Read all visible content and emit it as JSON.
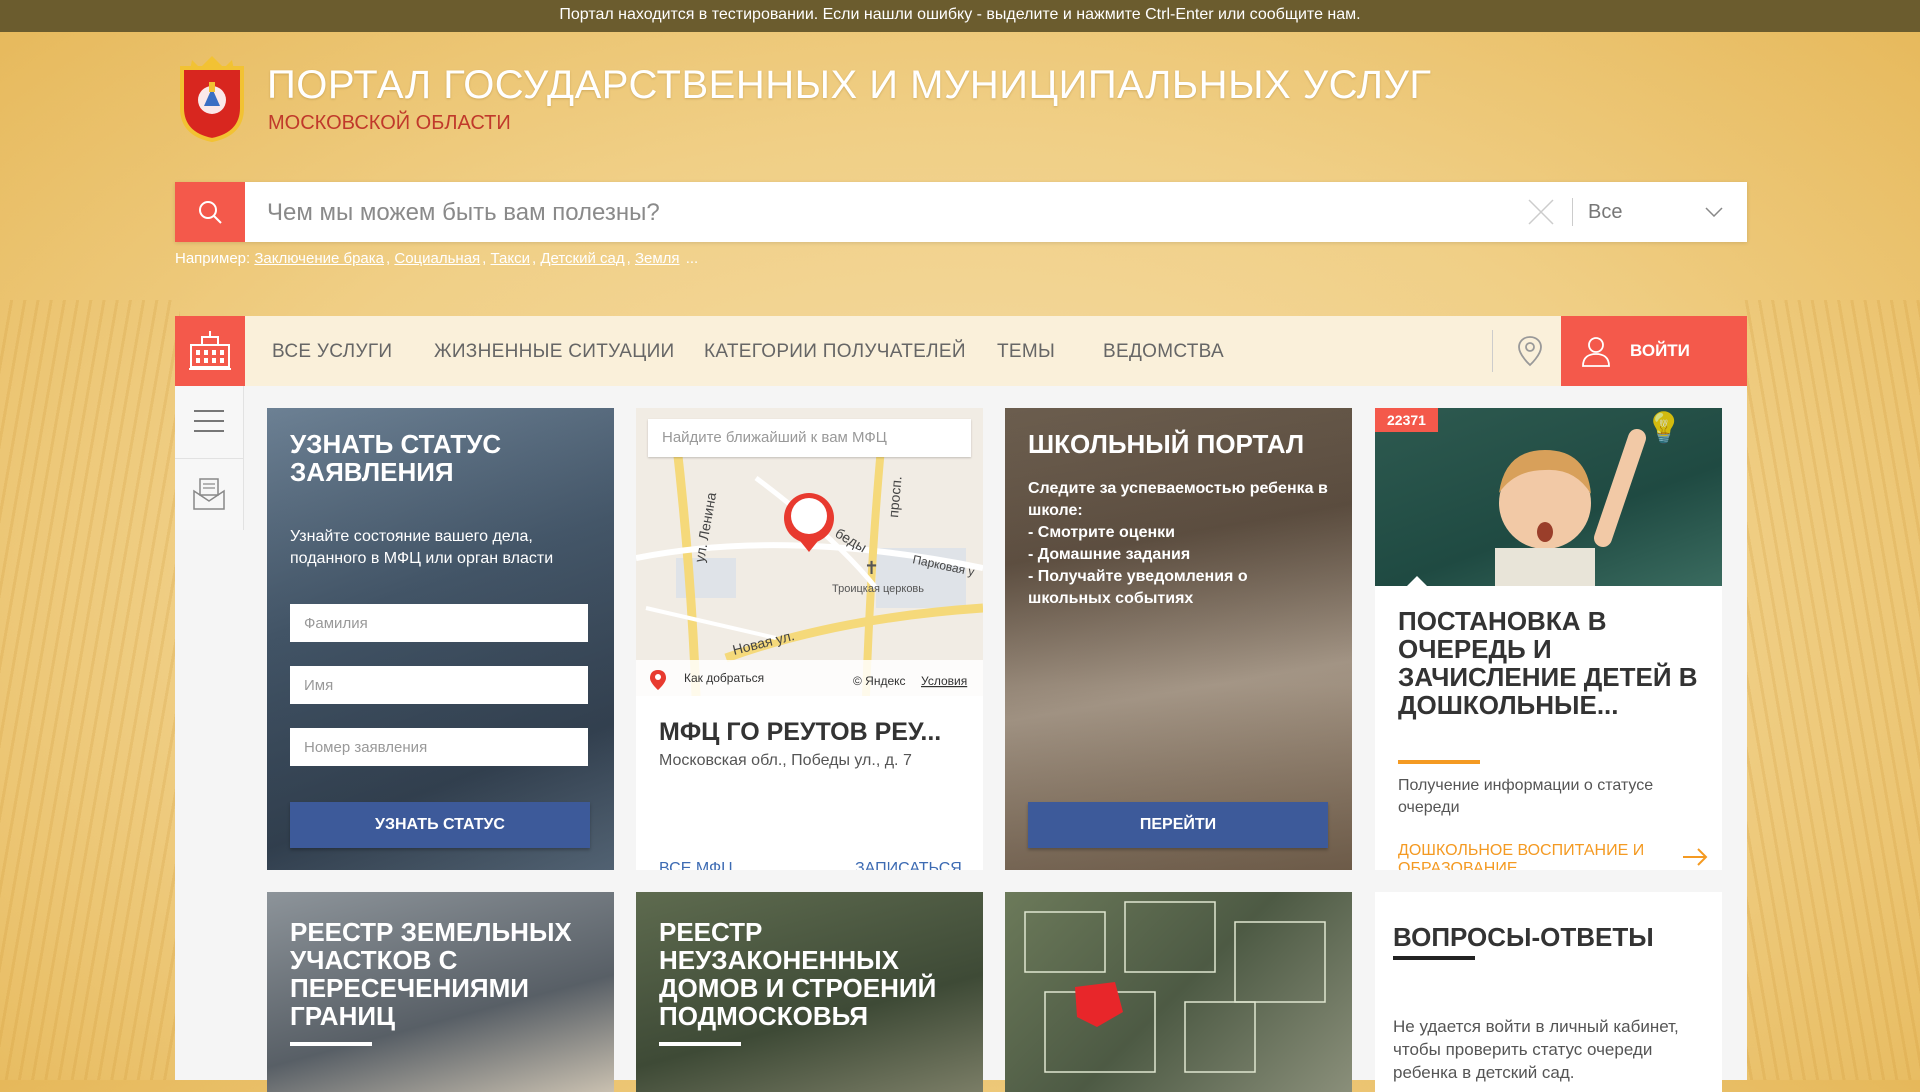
{
  "topbar": {
    "text": "Портал находится в тестировании. Если нашли ошибку - выделите и нажмите Ctrl-Enter или сообщите нам."
  },
  "header": {
    "title": "ПОРТАЛ ГОСУДАРСТВЕННЫХ И МУНИЦИПАЛЬНЫХ УСЛУГ",
    "subtitle": "МОСКОВСКОЙ ОБЛАСТИ"
  },
  "search": {
    "placeholder": "Чем мы можем быть вам полезны?",
    "scope": "Все"
  },
  "examples": {
    "label": "Например:",
    "items": [
      "Заключение брака",
      "Социальная",
      "Такси",
      "Детский сад",
      "Земля"
    ],
    "more": "..."
  },
  "nav": {
    "items": [
      "ВСЕ УСЛУГИ",
      "ЖИЗНЕННЫЕ СИТУАЦИИ",
      "КАТЕГОРИИ ПОЛУЧАТЕЛЕЙ",
      "ТЕМЫ",
      "ВЕДОМСТВА"
    ],
    "login": "ВОЙТИ"
  },
  "status_card": {
    "title": "УЗНАТЬ СТАТУС ЗАЯВЛЕНИЯ",
    "desc": "Узнайте состояние вашего дела, поданного в МФЦ или орган власти",
    "surname_placeholder": "Фамилия",
    "name_placeholder": "Имя",
    "number_placeholder": "Номер заявления",
    "button": "УЗНАТЬ СТАТУС"
  },
  "mfc_card": {
    "map_placeholder": "Найдите ближайший к вам МФЦ",
    "map_labels": {
      "street1": "ул. Ленина",
      "street2": "просп.",
      "street3": "беды",
      "street4": "Парковая у",
      "street5": "Новая ул.",
      "church": "Троицкая церковь",
      "route": "Как добраться",
      "yandex": "© Яндекс",
      "terms": "Условия"
    },
    "title": "МФЦ ГО РЕУТОВ РЕУ...",
    "address": "Московская обл., Победы ул., д. 7",
    "all_link": "ВСЕ МФЦ",
    "signup_link": "ЗАПИСАТЬСЯ"
  },
  "school_card": {
    "title": "ШКОЛЬНЫЙ ПОРТАЛ",
    "lines": [
      "Следите за успеваемостью ребенка в школе:",
      "- Смотрите оценки",
      "- Домашние задания",
      "- Получайте уведомления о школьных событиях"
    ],
    "button": "ПЕРЕЙТИ"
  },
  "queue_card": {
    "badge": "22371",
    "title": "ПОСТАНОВКА В ОЧЕРЕДЬ И ЗАЧИСЛЕНИЕ ДЕТЕЙ В ДОШКОЛЬНЫЕ...",
    "desc": "Получение информации о статусе очереди",
    "category": "ДОШКОЛЬНОЕ ВОСПИТАНИЕ И ОБРАЗОВАНИЕ"
  },
  "land_card": {
    "title": "РЕЕСТР ЗЕМЕЛЬНЫХ УЧАСТКОВ С ПЕРЕСЕЧЕНИЯМИ ГРАНИЦ"
  },
  "illegal_card": {
    "title": "РЕЕСТР НЕУЗАКОНЕННЫХ ДОМОВ И СТРОЕНИЙ ПОДМОСКОВЬЯ"
  },
  "faq_card": {
    "title": "ВОПРОСЫ-ОТВЕТЫ",
    "question": "Не удается войти в личный кабинет, чтобы проверить статус очереди ребенка в детский сад."
  },
  "colors": {
    "accent": "#f4594b",
    "blue": "#3d5a9a",
    "orange": "#f49a22",
    "topbar": "#6b5c2e"
  }
}
